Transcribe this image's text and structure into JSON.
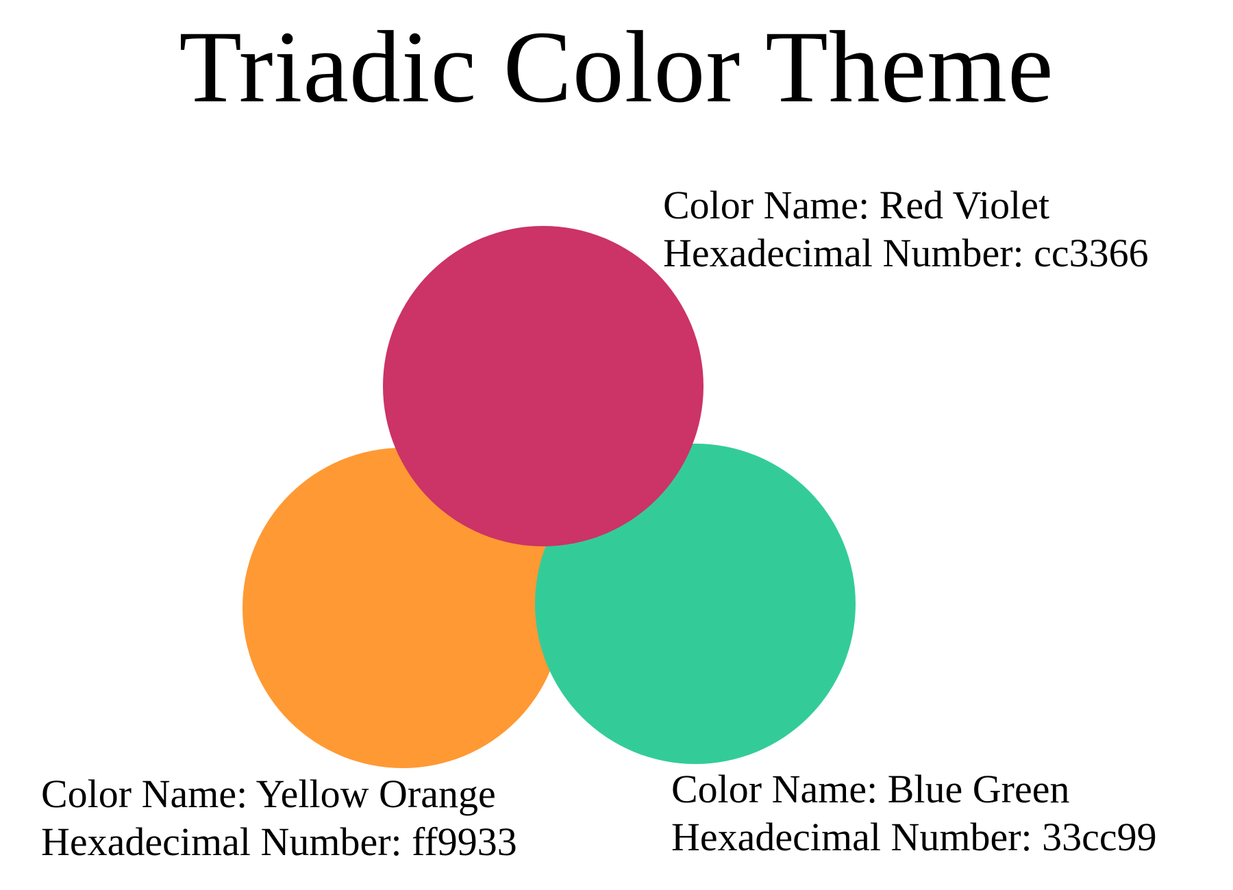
{
  "title": "Triadic Color Theme",
  "colors": {
    "red_violet": {
      "name_line": "Color Name: Red Violet",
      "hex_line": "Hexadecimal Number: cc3366",
      "swatch": "#cc3366"
    },
    "yellow_orange": {
      "name_line": "Color Name: Yellow Orange",
      "hex_line": "Hexadecimal Number: ff9933",
      "swatch": "#ff9933"
    },
    "blue_green": {
      "name_line": "Color Name: Blue Green",
      "hex_line": "Hexadecimal Number: 33cc99",
      "swatch": "#33cc99"
    }
  }
}
